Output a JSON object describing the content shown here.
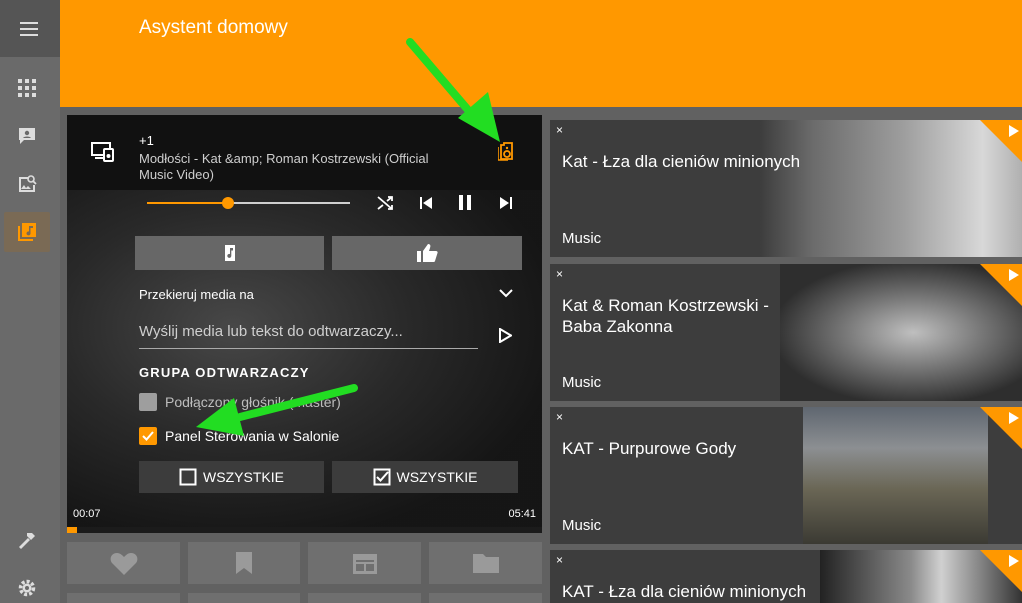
{
  "header": {
    "title": "Asystent domowy"
  },
  "sidebar": {
    "items": [
      {
        "icon": "menu-icon"
      },
      {
        "icon": "apps-icon"
      },
      {
        "icon": "chat-icon"
      },
      {
        "icon": "image-search-icon"
      },
      {
        "icon": "music-library-icon",
        "active": true
      },
      {
        "icon": "hammer-icon"
      },
      {
        "icon": "gear-icon"
      }
    ]
  },
  "player": {
    "queue_count": "+1",
    "track_title": "Modłości - Kat &amp; Roman Kostrzewski (Official Music Video)",
    "volume_fraction": 0.4,
    "redirect_label": "Przekieruj media na",
    "send_placeholder": "Wyślij media lub tekst do odtwarzaczy...",
    "group_heading": "GRUPA ODTWARZACZY",
    "group_items": [
      {
        "label": "Podłączony głośnik (master)",
        "checked": false
      },
      {
        "label": "Panel Sterowania w Salonie",
        "checked": true
      }
    ],
    "deselect_all_label": "WSZYSTKIE",
    "select_all_label": "WSZYSTKIE",
    "time_elapsed": "00:07",
    "time_total": "05:41",
    "progress_fraction": 0.021
  },
  "tiles": [
    {
      "close": "×",
      "title": "Kat - Łza dla cieniów minionych",
      "category": "Music"
    },
    {
      "close": "×",
      "title": "Kat & Roman Kostrzewski - Baba Zakonna",
      "category": "Music"
    },
    {
      "close": "×",
      "title": "KAT - Purpurowe Gody",
      "category": "Music"
    },
    {
      "close": "×",
      "title": "KAT - Łza dla cieniów minionych",
      "category": ""
    }
  ],
  "colors": {
    "accent": "#ff9800",
    "arrow": "#22dd22"
  }
}
